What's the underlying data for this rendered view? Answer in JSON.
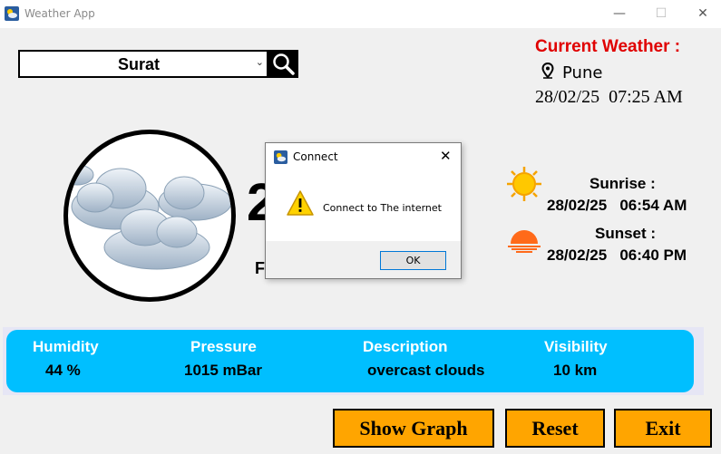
{
  "window": {
    "title": "Weather App",
    "minimize_glyph": "—",
    "maximize_glyph": "☐",
    "close_glyph": "✕"
  },
  "search": {
    "selected_city": "Surat",
    "dropdown_glyph": "⌄",
    "icon": "search-icon"
  },
  "current_weather": {
    "heading": "Current Weather :",
    "location": "Pune",
    "datetime": "28/02/25  07:25 AM",
    "heading_color": "#e00000"
  },
  "main": {
    "weather_icon": "overcast-clouds-icon",
    "temperature_partial": "2",
    "feels_like_partial": "F"
  },
  "sun": {
    "sunrise_label": "Sunrise :",
    "sunrise_value": "28/02/25   06:54 AM",
    "sunset_label": "Sunset :",
    "sunset_value": "28/02/25   06:40 PM"
  },
  "dialog": {
    "title": "Connect",
    "message": "Connect to The internet",
    "ok_label": "OK",
    "close_glyph": "✕",
    "icon": "warning-icon"
  },
  "info": {
    "bar_color": "#00bfff",
    "humidity_label": "Humidity",
    "humidity_value": "44 %",
    "pressure_label": "Pressure",
    "pressure_value": "1015 mBar",
    "description_label": "Description",
    "description_value": "overcast clouds",
    "visibility_label": "Visibility",
    "visibility_value": "10 km"
  },
  "buttons": {
    "show_graph": "Show Graph",
    "reset": "Reset",
    "exit": "Exit",
    "color": "#ffa500"
  }
}
